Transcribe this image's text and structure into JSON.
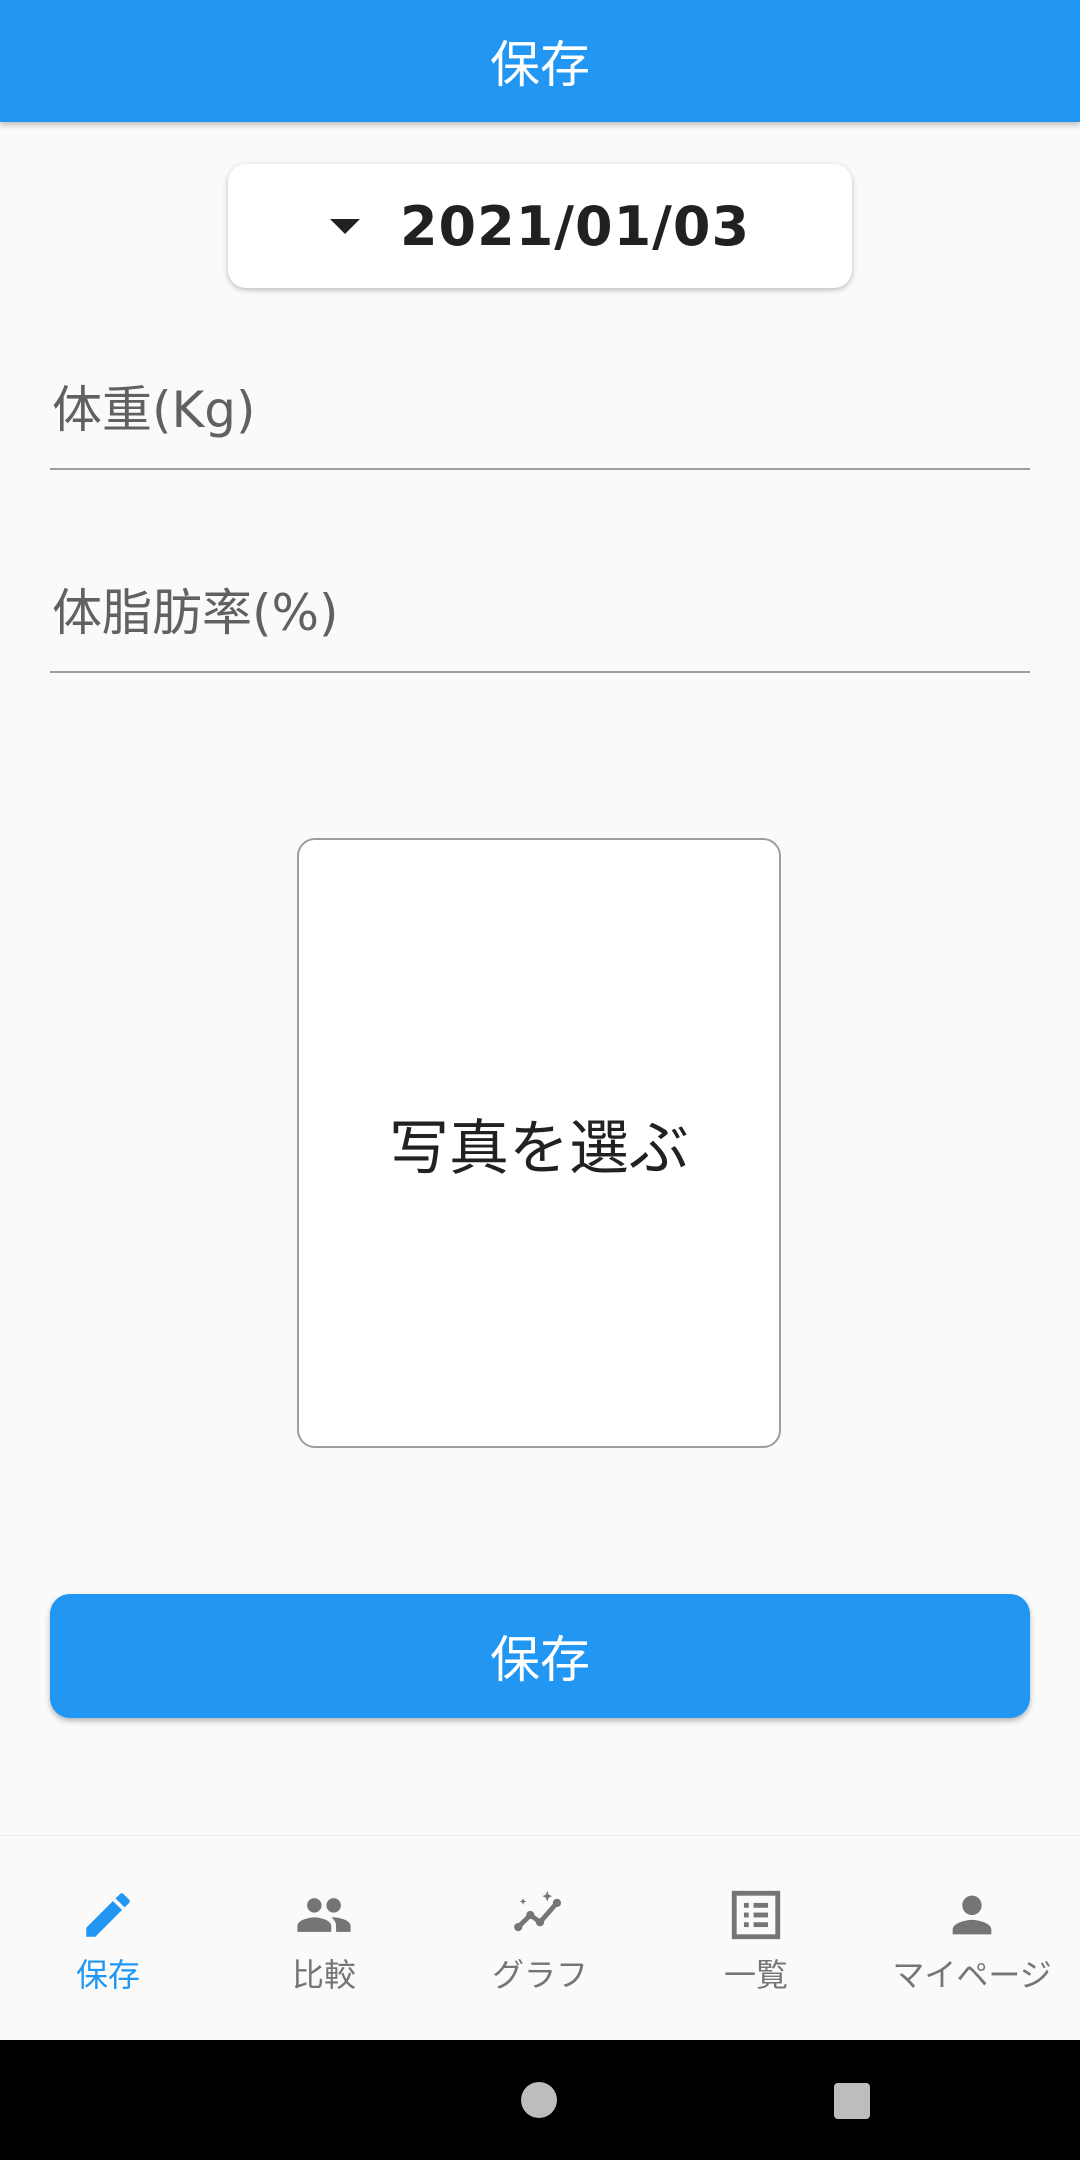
{
  "app_bar": {
    "title": "保存"
  },
  "date_picker": {
    "value": "2021/01/03"
  },
  "form": {
    "weight_label": "体重(Kg)",
    "body_fat_label": "体脂肪率(%)"
  },
  "photo": {
    "label": "写真を選ぶ"
  },
  "save_button": {
    "label": "保存"
  },
  "bottom_nav": {
    "items": [
      {
        "label": "保存",
        "icon": "pencil-icon",
        "active": true
      },
      {
        "label": "比較",
        "icon": "people-icon",
        "active": false
      },
      {
        "label": "グラフ",
        "icon": "auto-graph-icon",
        "active": false
      },
      {
        "label": "一覧",
        "icon": "list-icon",
        "active": false
      },
      {
        "label": "マイページ",
        "icon": "person-icon",
        "active": false
      }
    ]
  },
  "colors": {
    "primary": "#2196f3",
    "inactive": "#757575",
    "background": "#fafafa"
  }
}
